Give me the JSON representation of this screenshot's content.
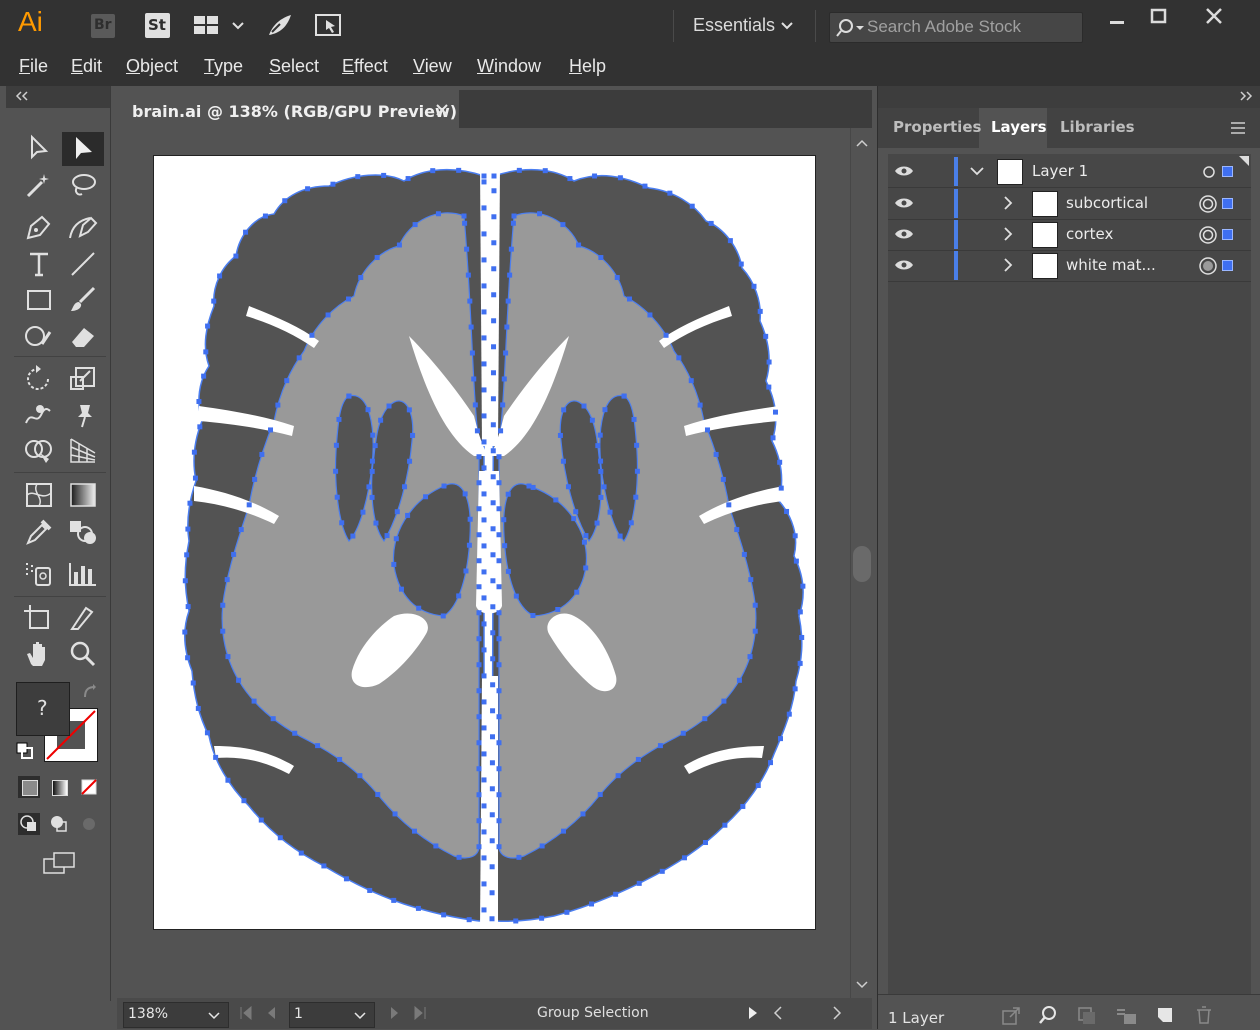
{
  "app": {
    "logo": "Ai",
    "bridge": "Br",
    "stock": "St"
  },
  "workspace": {
    "label": "Essentials"
  },
  "search": {
    "placeholder": "Search Adobe Stock"
  },
  "menu": [
    "File",
    "Edit",
    "Object",
    "Type",
    "Select",
    "Effect",
    "View",
    "Window",
    "Help"
  ],
  "document": {
    "tab_title": "brain.ai @ 138% (RGB/GPU Preview)"
  },
  "status": {
    "zoom": "138%",
    "artboard": "1",
    "tool": "Group Selection"
  },
  "panel": {
    "tabs": [
      "Properties",
      "Layers",
      "Libraries"
    ],
    "active_tab": "Layers",
    "layers": [
      {
        "name": "Layer 1",
        "level": 0,
        "expanded": true
      },
      {
        "name": "subcortical",
        "level": 1,
        "expanded": false
      },
      {
        "name": "cortex",
        "level": 1,
        "expanded": false
      },
      {
        "name": "white mat...",
        "level": 1,
        "expanded": false
      }
    ],
    "layer_count": "1 Layer"
  },
  "fill_stroke": {
    "fill_label": "?"
  },
  "colors": {
    "accent": "#4a7fe8",
    "ui_dark": "#323232",
    "ui_mid": "#535353",
    "shape_dark": "#535353",
    "shape_light": "#999999"
  }
}
